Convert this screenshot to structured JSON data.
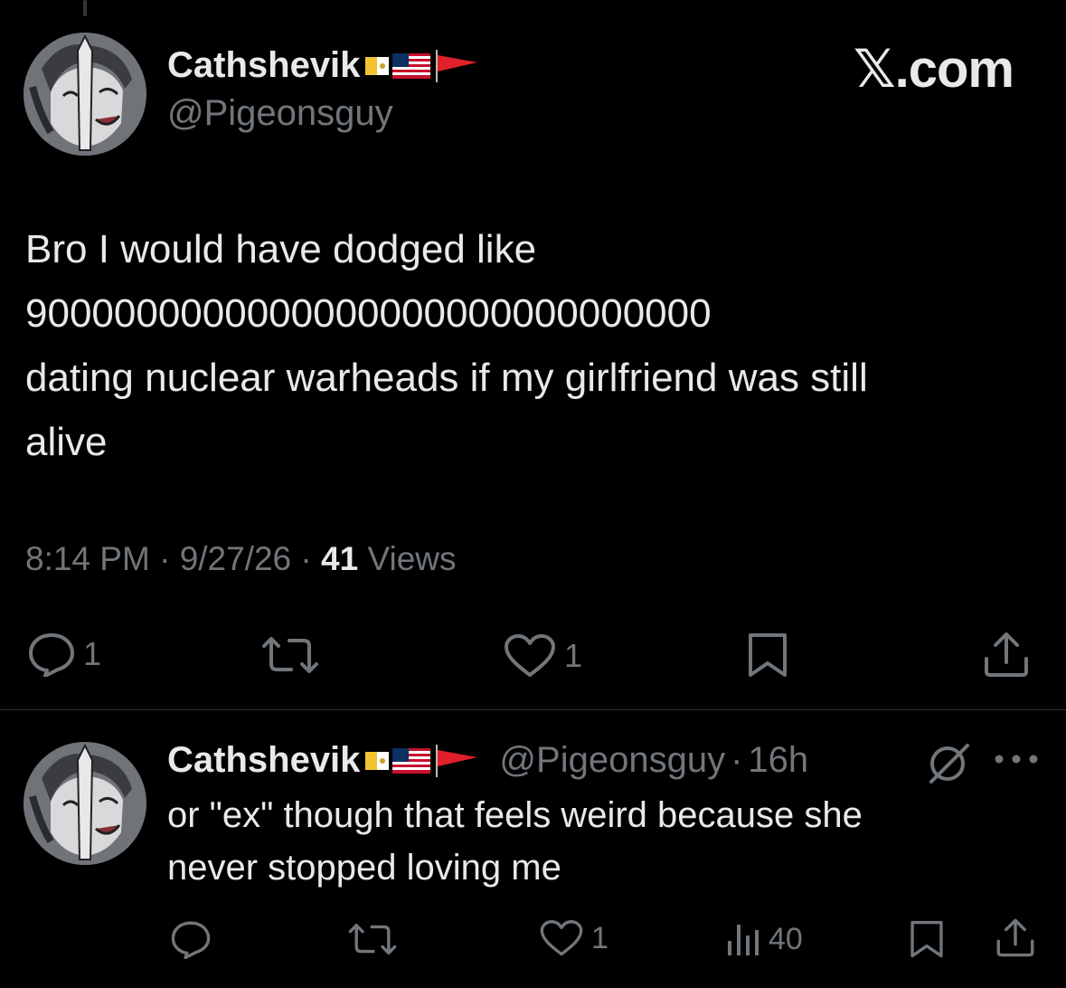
{
  "brand": "𝕏.com",
  "tweet": {
    "author_name": "Cathshevik",
    "author_handle": "@Pigeonsguy",
    "flags": [
      "vatican-flag-icon",
      "us-flag-icon",
      "red-flag-icon"
    ],
    "text": "Bro I would have dodged like\n9000000000000000000000000000000\ndating nuclear warheads if my girlfriend was still\nalive",
    "time": "8:14 PM",
    "date": "9/27/26",
    "views_count": "41",
    "views_label": "Views",
    "sep": "·",
    "actions": {
      "reply_count": "1",
      "repost_count": "",
      "like_count": "1"
    }
  },
  "reply": {
    "author_name": "Cathshevik",
    "author_handle": "@Pigeonsguy",
    "time_ago": "16h",
    "sep": "·",
    "text": "or \"ex\" though that feels weird because she\nnever stopped loving me",
    "actions": {
      "reply_count": "",
      "repost_count": "",
      "like_count": "1",
      "views_count": "40"
    }
  },
  "colors": {
    "background": "#000000",
    "text": "#e7e9ea",
    "muted": "#71767b",
    "divider": "#2f3336"
  }
}
